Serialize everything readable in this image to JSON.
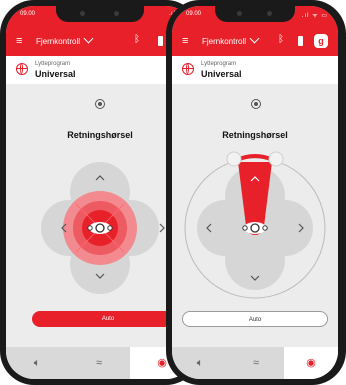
{
  "status_bar": {
    "time": "09.00",
    "signal_left": ".ıl",
    "signal_right": ".ıl ᯤ ▭"
  },
  "header": {
    "title": "Fjernkontroll",
    "badge": "g"
  },
  "program": {
    "label": "Lytteprogram",
    "value": "Universal"
  },
  "direction": {
    "heading": "Retningshørsel"
  },
  "auto_label": "Auto",
  "bottom_nav": {
    "items": [
      "volume",
      "tinnitus",
      "remote-control"
    ],
    "active": "remote-control"
  },
  "colors": {
    "accent": "#e8202a",
    "pad": "#d6d6d6",
    "background": "#ececec"
  }
}
